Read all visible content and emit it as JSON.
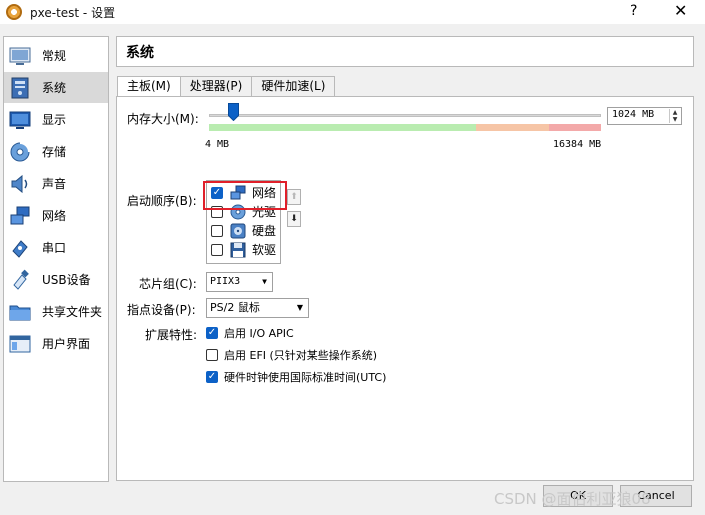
{
  "window": {
    "title": "pxe-test - 设置",
    "help_label": "?",
    "close_label": "✕"
  },
  "sidebar": {
    "items": [
      {
        "label": "常规",
        "icon": "general-icon"
      },
      {
        "label": "系统",
        "icon": "system-icon",
        "selected": true
      },
      {
        "label": "显示",
        "icon": "display-icon"
      },
      {
        "label": "存储",
        "icon": "storage-icon"
      },
      {
        "label": "声音",
        "icon": "audio-icon"
      },
      {
        "label": "网络",
        "icon": "network-icon"
      },
      {
        "label": "串口",
        "icon": "serial-port-icon"
      },
      {
        "label": "USB设备",
        "icon": "usb-icon"
      },
      {
        "label": "共享文件夹",
        "icon": "shared-folder-icon"
      },
      {
        "label": "用户界面",
        "icon": "user-interface-icon"
      }
    ]
  },
  "header": {
    "title": "系统"
  },
  "tabs": [
    {
      "label": "主板(M)",
      "active": true
    },
    {
      "label": "处理器(P)"
    },
    {
      "label": "硬件加速(L)"
    }
  ],
  "motherboard": {
    "memory_label": "内存大小(M):",
    "memory_value": "1024 MB",
    "memory_min_label": "4 MB",
    "memory_max_label": "16384 MB",
    "memory_slider_fraction": 0.063,
    "boot_order_label": "启动顺序(B):",
    "boot_items": [
      {
        "label": "网络",
        "checked": true,
        "icon": "network-icon"
      },
      {
        "label": "光驱",
        "checked": false,
        "icon": "optical-drive-icon"
      },
      {
        "label": "硬盘",
        "checked": false,
        "icon": "hard-disk-icon"
      },
      {
        "label": "软驱",
        "checked": false,
        "icon": "floppy-icon"
      }
    ],
    "chipset_label": "芯片组(C):",
    "chipset_value": "PIIX3",
    "pointing_label": "指点设备(P):",
    "pointing_value": "PS/2 鼠标",
    "extended_label": "扩展特性:",
    "features": [
      {
        "label": "启用 I/O APIC",
        "checked": true
      },
      {
        "label": "启用 EFI (只针对某些操作系统)",
        "checked": false
      },
      {
        "label": "硬件时钟使用国际标准时间(UTC)",
        "checked": true
      }
    ]
  },
  "buttons": {
    "ok": "OK",
    "cancel": "Cancel"
  },
  "watermark": "CSDN @面伯利亚狼08",
  "colors": {
    "accent": "#0c61c7",
    "highlight": "#e0202a",
    "scale_green": "#b9ecb0",
    "scale_orange": "#f6c5a6",
    "scale_red": "#f3a9a9"
  }
}
